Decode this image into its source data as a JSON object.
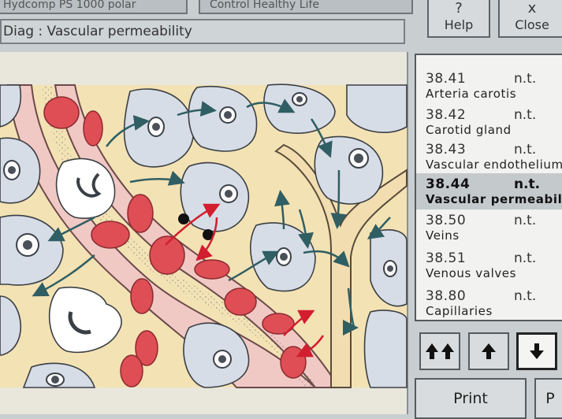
{
  "tabs": [
    "Hydcomp PS 1000 polar",
    "Control Healthy Life"
  ],
  "title": "Diag : Vascular permeability",
  "help": {
    "label": "Help",
    "icon": "?"
  },
  "close": {
    "label": "Close",
    "icon": "x"
  },
  "list": [
    {
      "code": "38.41",
      "status": "n.t.",
      "name": "Arteria carotis",
      "selected": false
    },
    {
      "code": "38.42",
      "status": "n.t.",
      "name": "Carotid gland",
      "selected": false
    },
    {
      "code": "38.43",
      "status": "n.t.",
      "name": "Vascular endothelium",
      "selected": false
    },
    {
      "code": "38.44",
      "status": "n.t.",
      "name": "Vascular permeability",
      "selected": true
    },
    {
      "code": "38.50",
      "status": "n.t.",
      "name": "Veins",
      "selected": false
    },
    {
      "code": "38.51",
      "status": "n.t.",
      "name": "Venous valves",
      "selected": false
    },
    {
      "code": "38.80",
      "status": "n.t.",
      "name": "Capillaries",
      "selected": false
    }
  ],
  "nav": {
    "first_icon": "double-up-arrow-icon",
    "up_icon": "up-arrow-icon",
    "down_icon": "down-arrow-icon"
  },
  "print_label": "Print",
  "print2_label": "P",
  "colors": {
    "vessel": "#f1c9c4",
    "cell": "#d7dde6",
    "rbc": "#df4e55",
    "interstitium": "#f3e2b4",
    "arrow_dark": "#2f5e63",
    "arrow_red": "#d21e2e"
  }
}
